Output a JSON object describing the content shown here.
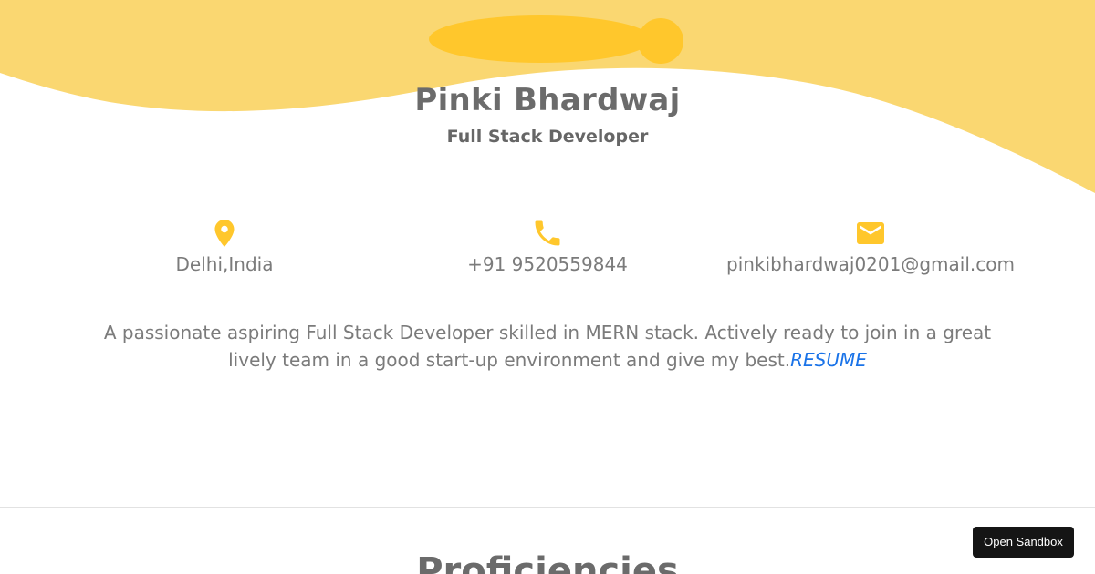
{
  "profile": {
    "name": "Pinki Bhardwaj",
    "role": "Full Stack Developer"
  },
  "contacts": {
    "location": {
      "icon": "location-pin-icon",
      "text": "Delhi,India"
    },
    "phone": {
      "icon": "phone-icon",
      "text": "+91 9520559844"
    },
    "email": {
      "icon": "mail-icon",
      "text": "pinkibhardwaj0201@gmail.com"
    }
  },
  "bio": {
    "text": "A passionate aspiring Full Stack Developer skilled in MERN stack. Actively ready to join in a great lively team in a good start-up environment and give my best.",
    "resume_link": "RESUME"
  },
  "next_section": {
    "title": "Proficiencies"
  },
  "sandbox": {
    "button_label": "Open Sandbox"
  },
  "colors": {
    "wave": "#fad771",
    "accent": "#ffc72c",
    "text": "#7b7b7b",
    "heading": "#6b6b6b",
    "link": "#1a73e8",
    "button_bg": "#151515"
  }
}
